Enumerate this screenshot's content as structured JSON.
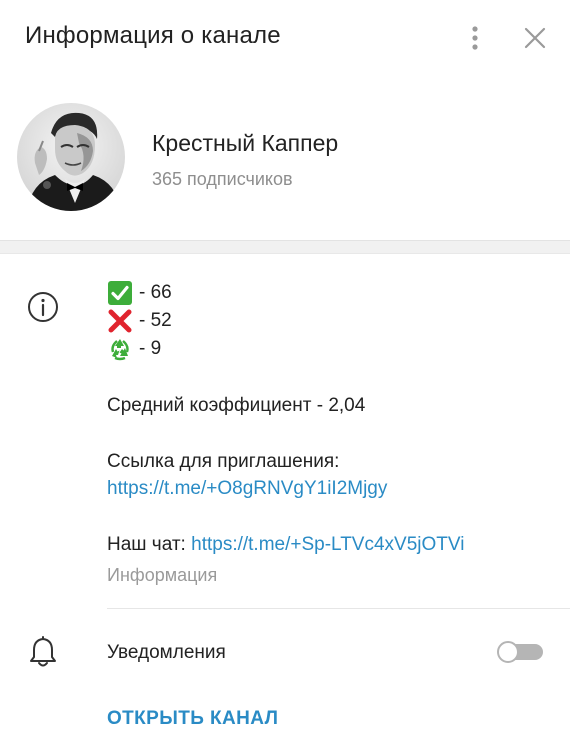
{
  "header": {
    "title": "Информация о канале",
    "more_icon": "more-vertical-icon",
    "close_icon": "close-icon"
  },
  "channel": {
    "name": "Крестный Каппер",
    "subscribers": "365 подписчиков",
    "avatar": "godfather-portrait"
  },
  "info": {
    "icon": "info-icon",
    "stats": [
      {
        "icon": "check-mark-icon",
        "text": "- 66",
        "color": "#3dad3a"
      },
      {
        "icon": "cross-mark-icon",
        "text": "- 52",
        "color": "#e0242e"
      },
      {
        "icon": "recycle-icon",
        "text": "- 9",
        "color": "#3dad3a"
      }
    ],
    "avg_coefficient": "Средний коэффициент - 2,04",
    "invite_label": "Ссылка для приглашения:",
    "invite_link": "https://t.me/+O8gRNVgY1iI2Mjgy",
    "chat_label": "Наш чат:",
    "chat_link": "https://t.me/+Sp-LTVc4xV5jOTVi",
    "caption": "Информация"
  },
  "notifications": {
    "icon": "bell-icon",
    "label": "Уведомления",
    "enabled": false
  },
  "actions": {
    "open_channel": "ОТКРЫТЬ КАНАЛ"
  },
  "colors": {
    "link": "#2a8bc5",
    "text": "#222222",
    "secondary": "#8e8e8e"
  }
}
